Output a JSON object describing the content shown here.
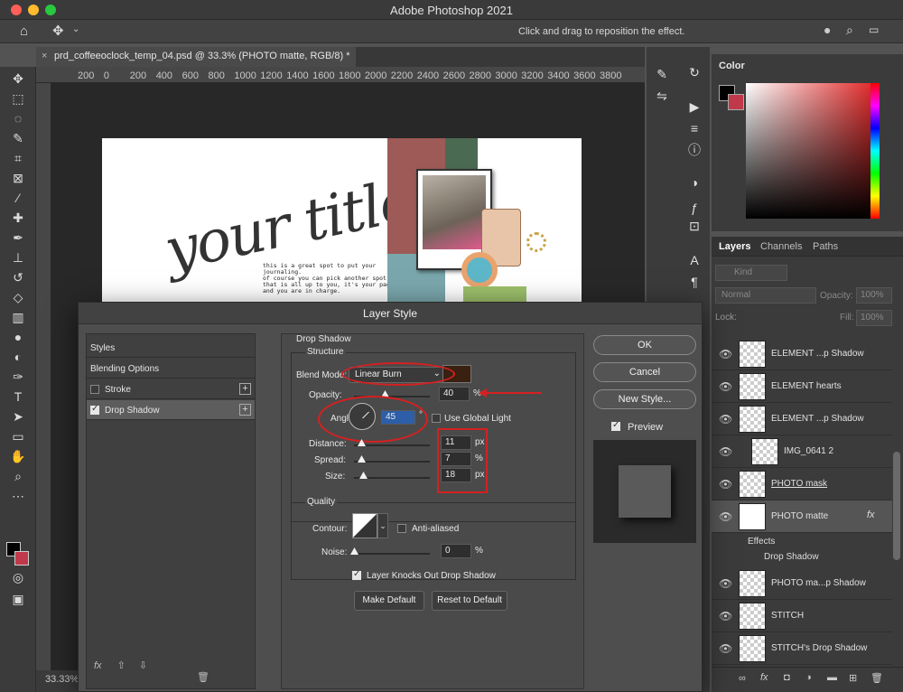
{
  "app": {
    "title": "Adobe Photoshop 2021",
    "options_hint": "Click and drag to reposition the effect.",
    "doc_tab": "prd_coffeeoclock_temp_04.psd @ 33.3% (PHOTO matte, RGB/8) *",
    "zoom": "33.33%"
  },
  "ruler": {
    "ticks": [
      "200",
      "0",
      "200",
      "400",
      "600",
      "800",
      "1000",
      "1200",
      "1400",
      "1600",
      "1800",
      "2000",
      "2200",
      "2400",
      "2600",
      "2800",
      "3000",
      "3200",
      "3400",
      "3600",
      "3800"
    ]
  },
  "document": {
    "title_text": "your title",
    "journal_line1": "this is a great spot to put your",
    "journal_line2": "journaling.",
    "journal_line3": "of course you can pick another spot,",
    "journal_line4": "that is all up to you, it's your page",
    "journal_line5": "and you are in charge."
  },
  "color_panel": {
    "title": "Color",
    "fg": "#000000",
    "bg": "#c0394a"
  },
  "layers_panel": {
    "tabs": [
      "Layers",
      "Channels",
      "Paths"
    ],
    "kind_placeholder": "Kind",
    "blend": "Normal",
    "opacity_label": "Opacity:",
    "opacity_value": "100%",
    "lock_label": "Lock:",
    "fill_label": "Fill:",
    "fill_value": "100%",
    "layers": [
      {
        "name": "ELEMENT ...p Shadow"
      },
      {
        "name": "ELEMENT hearts"
      },
      {
        "name": "ELEMENT ...p Shadow"
      },
      {
        "name": "IMG_0641 2"
      },
      {
        "name": "PHOTO mask"
      },
      {
        "name": "PHOTO matte"
      },
      {
        "name": "PHOTO ma...p Shadow"
      },
      {
        "name": "STITCH"
      },
      {
        "name": "STITCH's Drop Shadow"
      }
    ],
    "effects_label": "Effects",
    "effect_item": "Drop Shadow"
  },
  "dialog": {
    "title": "Layer Style",
    "style_items": [
      "Styles",
      "Blending Options",
      "Stroke",
      "Drop Shadow"
    ],
    "section_title": "Drop Shadow",
    "structure_label": "Structure",
    "blend_mode_label": "Blend Mode:",
    "blend_mode_value": "Linear Burn",
    "shadow_color": "#3a2010",
    "opacity_label": "Opacity:",
    "opacity_value": "40",
    "angle_label": "Angle:",
    "angle_value": "45",
    "use_global_light": "Use Global Light",
    "distance_label": "Distance:",
    "distance_value": "11",
    "spread_label": "Spread:",
    "spread_value": "7",
    "size_label": "Size:",
    "size_value": "18",
    "unit_px": "px",
    "unit_pct": "%",
    "unit_deg": "°",
    "quality_label": "Quality",
    "contour_label": "Contour:",
    "anti_aliased": "Anti-aliased",
    "noise_label": "Noise:",
    "noise_value": "0",
    "layer_knocks_out": "Layer Knocks Out Drop Shadow",
    "make_default": "Make Default",
    "reset_default": "Reset to Default",
    "ok": "OK",
    "cancel": "Cancel",
    "new_style": "New Style...",
    "preview": "Preview",
    "fx": "fx"
  }
}
